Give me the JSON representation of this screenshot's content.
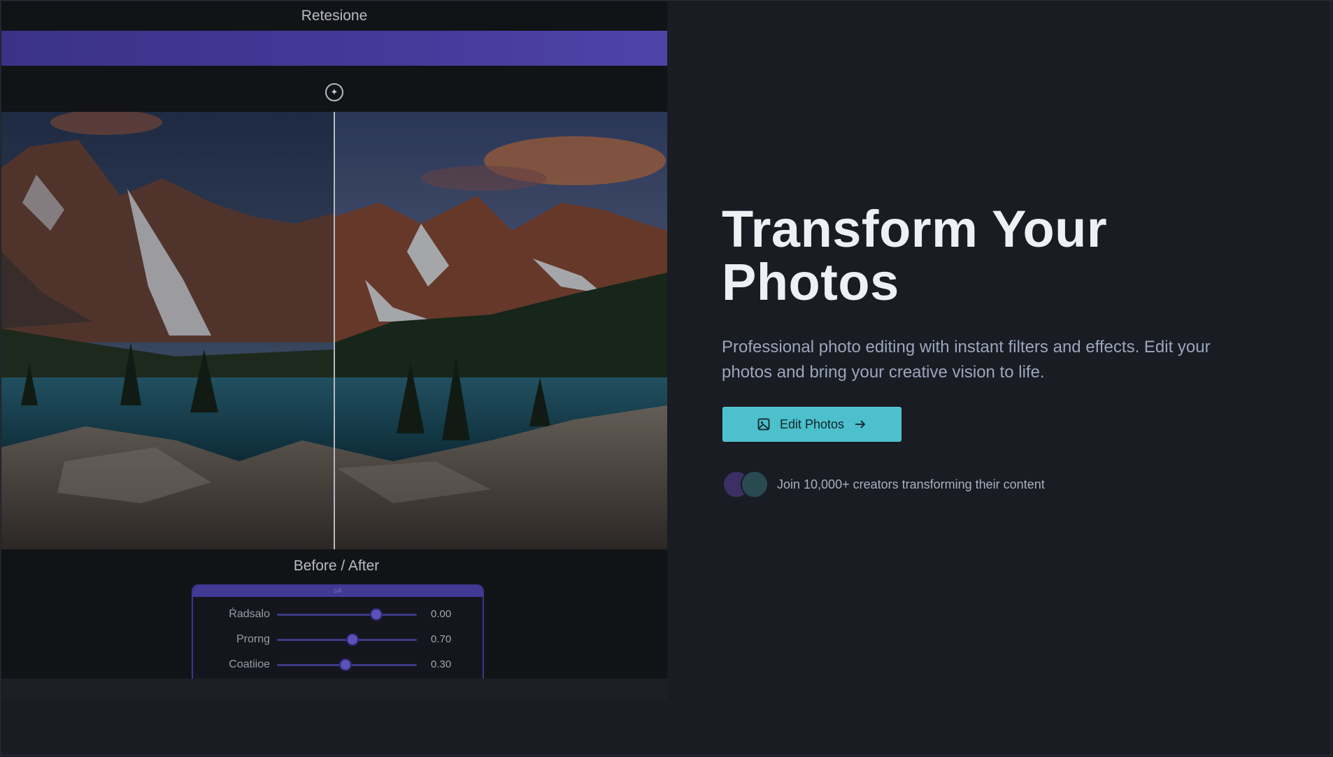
{
  "editor": {
    "title": "Retesione",
    "comparison_label": "Before / After",
    "panel_header": "sA",
    "adjustments": [
      {
        "label": "Ŕadsalo",
        "value_text": "0.00",
        "level": 0.71
      },
      {
        "label": "Prorng",
        "value_text": "0.70",
        "level": 0.54
      },
      {
        "label": "Coatiioe",
        "value_text": "0.30",
        "level": 0.49
      }
    ],
    "split_position": 0.5,
    "icons": {
      "split_handle": "compare-handle-icon"
    }
  },
  "hero": {
    "title": "Transform Your Photos",
    "subtitle": "Professional photo editing with instant filters and effects. Edit your photos and bring your creative vision to life.",
    "cta_label": "Edit Photos",
    "cta_icons": [
      "image-icon",
      "arrow-right-icon"
    ],
    "social_proof": "Join 10,000+ creators transforming their content"
  },
  "colors": {
    "background": "#1a1c23",
    "accent": "#4cc0cc",
    "editor_purple": "#46399a"
  }
}
